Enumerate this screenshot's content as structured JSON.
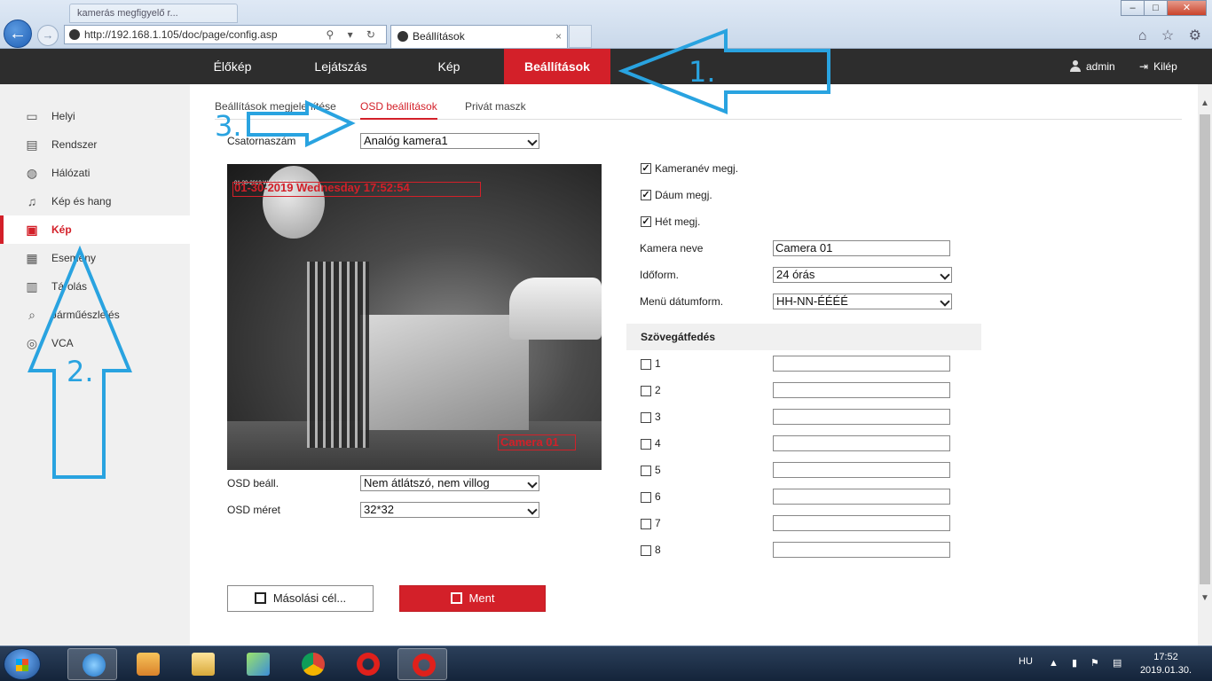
{
  "browser": {
    "background_tab_title": "kamerás megfigyelő r...",
    "address": "http://192.168.1.105/doc/page/config.asp",
    "address_tools": "⚲ ▾ ↻",
    "active_tab_title": "Beállítások",
    "tab_close": "×",
    "window_buttons": [
      "–",
      "□",
      "✕"
    ],
    "right_tools": "⌂ ☆ ⚙"
  },
  "topnav": {
    "items": [
      "Élőkép",
      "Lejátszás",
      "Kép",
      "Beállítások"
    ],
    "active_index": 3,
    "user": "admin",
    "logout": "Kilép"
  },
  "sidebar": {
    "items": [
      {
        "label": "Helyi",
        "icon": "monitor-icon"
      },
      {
        "label": "Rendszer",
        "icon": "system-icon"
      },
      {
        "label": "Hálózati",
        "icon": "globe-icon"
      },
      {
        "label": "Kép és hang",
        "icon": "microphone-icon"
      },
      {
        "label": "Kép",
        "icon": "image-icon"
      },
      {
        "label": "Esemény",
        "icon": "calendar-icon"
      },
      {
        "label": "Tárolás",
        "icon": "storage-icon"
      },
      {
        "label": "Járműészlelés",
        "icon": "vehicle-search-icon"
      },
      {
        "label": "VCA",
        "icon": "vca-icon"
      }
    ],
    "active_index": 4
  },
  "subtabs": [
    "Beállítások megjelenítése",
    "OSD beállítások",
    "Privát maszk"
  ],
  "subtab_active_index": 1,
  "form": {
    "channel_label": "Csatornaszám",
    "channel_value": "Analóg kamera1",
    "osd_mode_label": "OSD beáll.",
    "osd_mode_value": "Nem átlátszó, nem villog",
    "osd_size_label": "OSD méret",
    "osd_size_value": "32*32"
  },
  "video": {
    "osd_date": "01-30-2019 Wednesday 17:52:54",
    "osd_date_small": "01-30-2019 Wed 17:52:07",
    "osd_camera_name": "Camera 01"
  },
  "display": {
    "show_camera_name_label": "Kameranév megj.",
    "show_camera_name_checked": true,
    "show_date_label": "Dáum megj.",
    "show_date_checked": true,
    "show_week_label": "Hét megj.",
    "show_week_checked": true,
    "camera_name_label": "Kamera neve",
    "camera_name_value": "Camera 01",
    "time_format_label": "Időform.",
    "time_format_value": "24 órás",
    "date_format_label": "Menü dátumform.",
    "date_format_value": "HH-NN-ÉÉÉÉ"
  },
  "overlay": {
    "header": "Szövegátfedés",
    "items": [
      {
        "label": "1",
        "checked": false,
        "value": ""
      },
      {
        "label": "2",
        "checked": false,
        "value": ""
      },
      {
        "label": "3",
        "checked": false,
        "value": ""
      },
      {
        "label": "4",
        "checked": false,
        "value": ""
      },
      {
        "label": "5",
        "checked": false,
        "value": ""
      },
      {
        "label": "6",
        "checked": false,
        "value": ""
      },
      {
        "label": "7",
        "checked": false,
        "value": ""
      },
      {
        "label": "8",
        "checked": false,
        "value": ""
      }
    ]
  },
  "buttons": {
    "copy": "Másolási cél...",
    "save": "Ment"
  },
  "annotations": [
    "1.",
    "2.",
    "3."
  ],
  "taskbar": {
    "language": "HU",
    "tray_icons": "▲ ▮ ⚑ ▤",
    "time": "17:52",
    "date": "2019.01.30."
  },
  "colors": {
    "accent": "#d32029",
    "nav_bg": "#2d2d2d",
    "annotation": "#29a3e0"
  }
}
